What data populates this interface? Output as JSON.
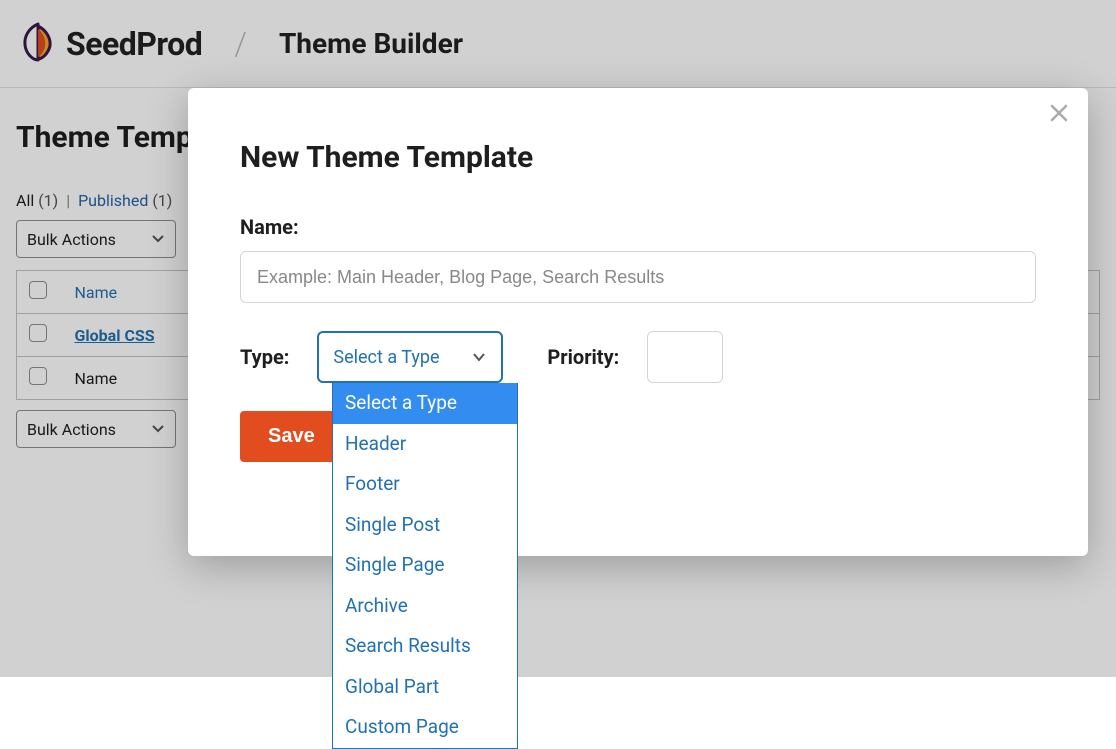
{
  "header": {
    "brand": "SeedProd",
    "breadcrumb": "Theme Builder"
  },
  "page": {
    "title": "Theme Templates",
    "statuses": {
      "all_label": "All",
      "all_count": "(1)",
      "separator": "|",
      "published_label": "Published",
      "published_count": "(1)"
    },
    "bulk_actions_label": "Bulk Actions",
    "columns": {
      "name": "Name"
    },
    "rows": [
      {
        "name": "Global CSS"
      }
    ]
  },
  "modal": {
    "title": "New Theme Template",
    "name_label": "Name:",
    "name_placeholder": "Example: Main Header, Blog Page, Search Results",
    "type_label": "Type:",
    "type_selected": "Select a Type",
    "type_options": [
      "Select a Type",
      "Header",
      "Footer",
      "Single Post",
      "Single Page",
      "Archive",
      "Search Results",
      "Global Part",
      "Custom Page"
    ],
    "priority_label": "Priority:",
    "save_label": "Save"
  }
}
